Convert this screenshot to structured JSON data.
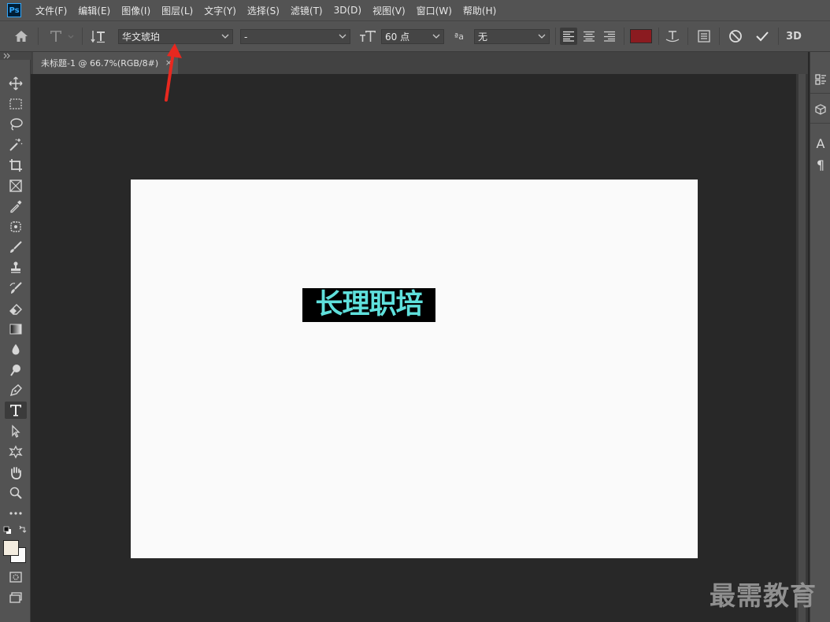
{
  "app": {
    "logo": "Ps"
  },
  "menu": [
    "文件(F)",
    "编辑(E)",
    "图像(I)",
    "图层(L)",
    "文字(Y)",
    "选择(S)",
    "滤镜(T)",
    "3D(D)",
    "视图(V)",
    "窗口(W)",
    "帮助(H)"
  ],
  "options": {
    "font_family": "华文琥珀",
    "font_style": "-",
    "font_size": "60 点",
    "antialias_glyph": "ªa",
    "antialias": "无",
    "text_color": "#8b1b20",
    "three_d_label": "3D"
  },
  "document": {
    "tab_title": "未标题-1 @ 66.7%(RGB/8#)",
    "close_glyph": "×",
    "canvas_text": "长理职培",
    "text_color": "#5fe0dc"
  },
  "icons": {
    "home": "home-icon",
    "type_tool": "type-tool-icon",
    "orientation": "text-orientation-icon",
    "font_size": "font-size-icon",
    "align_left": "align-left-icon",
    "align_center": "align-center-icon",
    "align_right": "align-right-icon",
    "warp": "warp-text-icon",
    "panels": "character-panel-icon",
    "cancel": "cancel-icon",
    "commit": "commit-check-icon"
  },
  "right_panel": [
    "A",
    "¶"
  ],
  "watermark": "最需教育"
}
